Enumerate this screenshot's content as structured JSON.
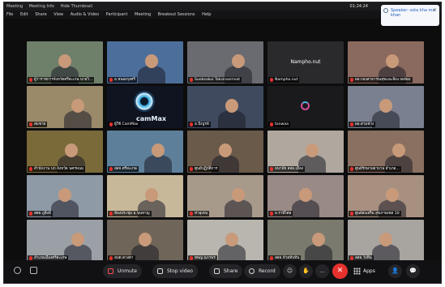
{
  "titlebar": {
    "items": [
      "Meeting",
      "Meeting Info",
      "Hide Thumbnail"
    ],
    "clock": "01:24:24"
  },
  "menubar": {
    "items": [
      "File",
      "Edit",
      "Share",
      "View",
      "Audio & Video",
      "Participant",
      "Meeting",
      "Breakout Sessions",
      "Help"
    ]
  },
  "toast": {
    "text": "Speaker: sota kha ma khan"
  },
  "tiles": [
    {
      "name": "ผู้ว่าราชการจังหวัดศรีสะเกษ นายวิ...",
      "bg": "#6e7f6a"
    },
    {
      "name": "อ.หนองกุงศรี",
      "bg": "#4c6e9a"
    },
    {
      "name": "Suebsakul Taksinasirivat",
      "bg": "#6a6b70"
    },
    {
      "name": "Nampho.nut",
      "bg": "#2a2a2c",
      "center": true
    },
    {
      "name": "ผอ.กองสาธารณสุขและสิ่งแวดล้อม",
      "bg": "#8a6a5e"
    },
    {
      "name": "สมชาย",
      "bg": "#9a8a6a"
    },
    {
      "name": "ผู้ใช้ CamMax",
      "bg": "#0f1420",
      "logo": "camMax"
    },
    {
      "name": "อ.บึงบูรพ์",
      "bg": "#3f4a5e"
    },
    {
      "name": "tonwaa",
      "bg": "#1a1a1c",
      "loading": true
    },
    {
      "name": "ผอ.สามช่าง",
      "bg": "#7a8090"
    },
    {
      "name": "สำนักงาน ปภ.จังหวัด นครพนม",
      "bg": "#7a6a3a"
    },
    {
      "name": "สสจ.ศรีสะเกษ",
      "bg": "#5d7f9a"
    },
    {
      "name": "ศูนย์ปฏิบัติการ",
      "bg": "#6a5a4a"
    },
    {
      "name": "อนามัย สสอ.เมือง",
      "bg": "#b0a89e"
    },
    {
      "name": "ศูนย์รักษาพยาบาล อำเภอ...",
      "bg": "#8a7060"
    },
    {
      "name": "สสอ.ภูสิงห์",
      "bg": "#8e9aa6"
    },
    {
      "name": "ห้องประชุม อ.ขุนหาญ",
      "bg": "#c8b89a"
    },
    {
      "name": "ท่าอุเทน",
      "bg": "#a89a8a"
    },
    {
      "name": "อ.ราษีไศล",
      "bg": "#9a8a86"
    },
    {
      "name": "ศูนย์ส่งเสริม สุขภาพเขต 10",
      "bg": "#a89080"
    },
    {
      "name": "อำเภอเมืองศรีสะเกษ",
      "bg": "#9aa0a6"
    },
    {
      "name": "อบต.ดวงตา",
      "bg": "#6f6558"
    },
    {
      "name": "ทพญ.นภาพร",
      "bg": "#b8b6ae"
    },
    {
      "name": "สสอ.ห้วยทับทัน",
      "bg": "#7a7a6e"
    },
    {
      "name": "สสอ.วังหิน",
      "bg": "#a8a4a0"
    }
  ],
  "toolbar": {
    "unmute": "Unmute",
    "stop_video": "Stop video",
    "share": "Share",
    "record": "Record",
    "apps": "Apps"
  }
}
